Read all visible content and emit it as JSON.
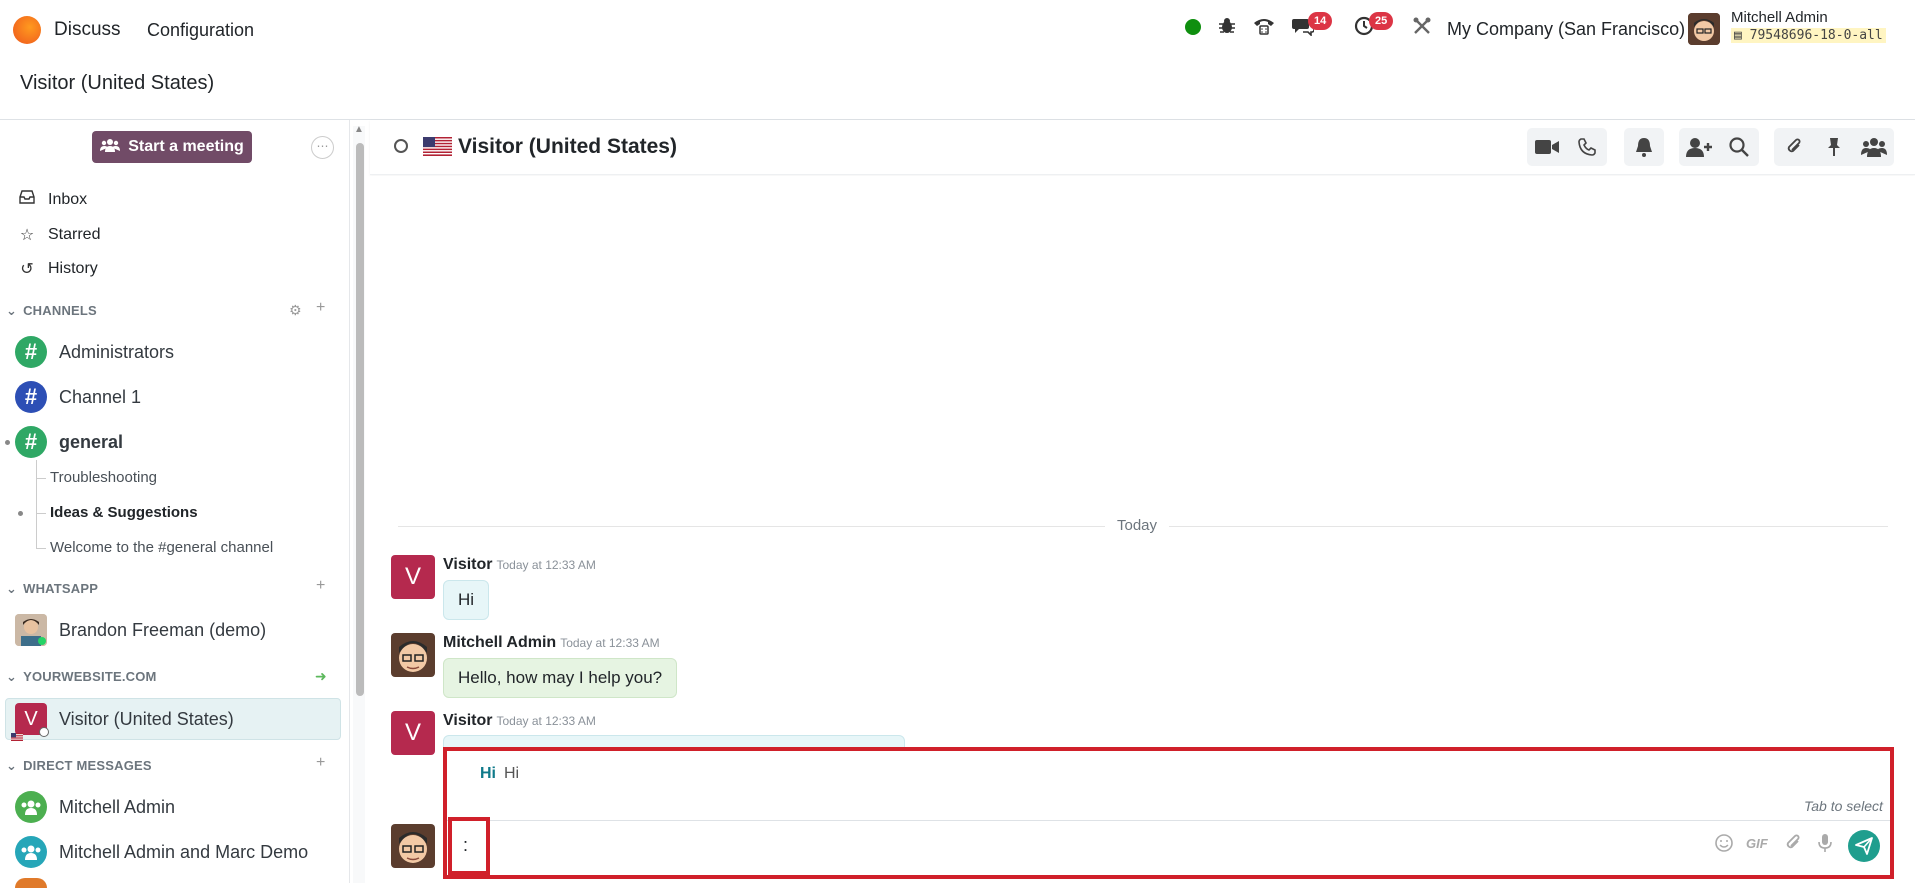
{
  "topbar": {
    "app_name": "Discuss",
    "menu_config": "Configuration",
    "badge_messages": "14",
    "badge_activities": "25",
    "company": "My Company (San Francisco)",
    "user_name": "Mitchell Admin",
    "db_name": "79548696-18-0-all"
  },
  "breadcrumb": "Visitor (United States)",
  "sidebar": {
    "meeting_button": "Start a meeting",
    "nav": [
      "Inbox",
      "Starred",
      "History"
    ],
    "channels_header": "CHANNELS",
    "channels": [
      "Administrators",
      "Channel 1",
      "general"
    ],
    "sub_channels": [
      "Troubleshooting",
      "Ideas & Suggestions",
      "Welcome to the #general channel"
    ],
    "whatsapp_header": "WHATSAPP",
    "whatsapp_contact": "Brandon Freeman (demo)",
    "website_header": "YOURWEBSITE.COM",
    "website_visitor": "Visitor (United States)",
    "website_avatar_letter": "V",
    "dm_header": "DIRECT MESSAGES",
    "dms": [
      "Mitchell Admin",
      "Mitchell Admin and Marc Demo"
    ]
  },
  "thread": {
    "title": "Visitor (United States)",
    "day_separator": "Today",
    "messages": [
      {
        "author": "Visitor",
        "time": "Today at 12:33 AM",
        "text": "Hi",
        "avatar_letter": "V"
      },
      {
        "author": "Mitchell Admin",
        "time": "Today at 12:33 AM",
        "text": "Hello, how may I help you?"
      },
      {
        "author": "Visitor",
        "time": "Today at 12:33 AM",
        "avatar_letter": "V"
      }
    ]
  },
  "suggestion": {
    "key": "Hi",
    "value": "Hi",
    "hint": "Tab to select"
  },
  "composer": {
    "value": ":",
    "gif_label": "GIF"
  },
  "colors": {
    "primary": "#714b67",
    "visitor_avatar": "#b5294e",
    "highlight": "#d0202a",
    "send": "#1f9e8e"
  }
}
